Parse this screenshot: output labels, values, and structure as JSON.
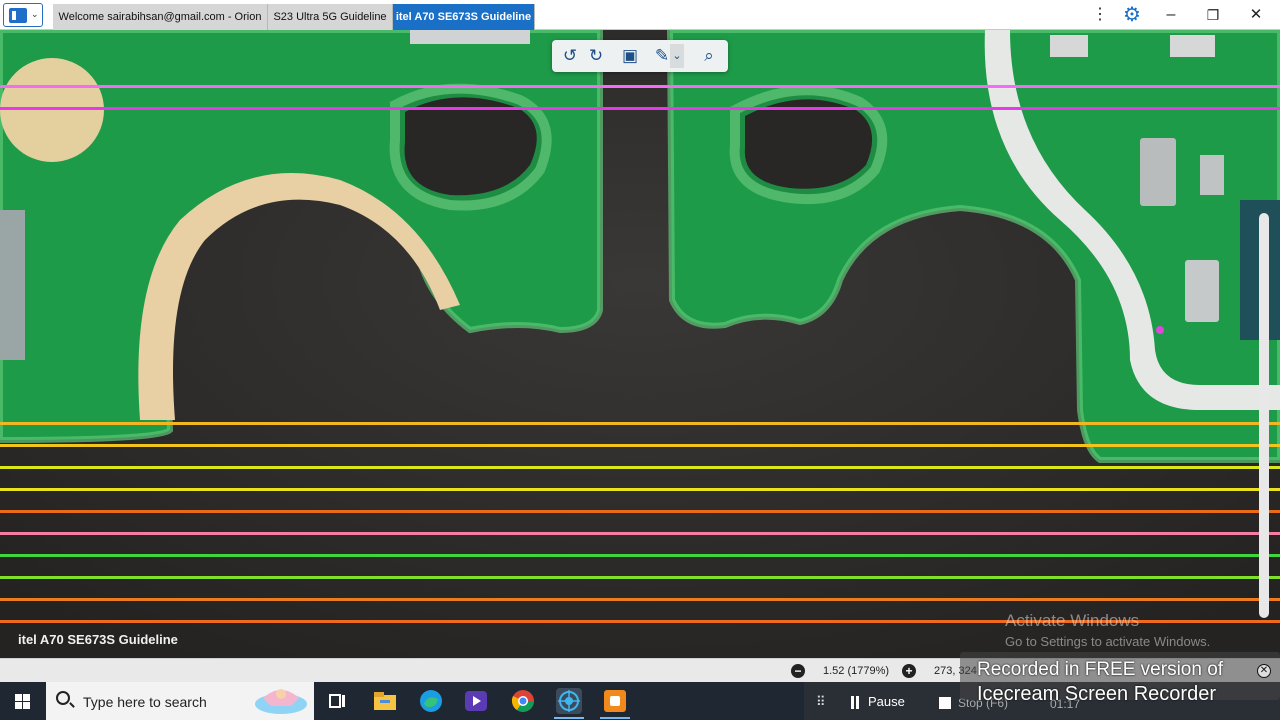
{
  "window": {
    "tabs": [
      {
        "label": "Welcome sairabihsan@gmail.com - Orion",
        "active": false
      },
      {
        "label": "S23 Ultra 5G Guideline",
        "active": false
      },
      {
        "label": "itel A70 SE673S Guideline",
        "active": true
      }
    ],
    "controls": {
      "kebab": "⋮",
      "settings": "⚙",
      "minimize": "–",
      "restore": "❐",
      "close": "✕"
    }
  },
  "viewer": {
    "caption": "itel A70 SE673S Guideline",
    "trace_colors": [
      "#f36cf3",
      "#e53ae6",
      "#f2b622",
      "#f3c41c",
      "#d8e81d",
      "#e9e21f",
      "#ea6a19",
      "#f47ea3",
      "#3ed63b",
      "#7fe02a",
      "#ef7b1f",
      "#ef6a1f"
    ],
    "toolbar_icons": [
      "rotate-left-icon",
      "rotate-right-icon",
      "fit-screen-icon",
      "pen-icon",
      "chevron-down-icon",
      "search-icon"
    ]
  },
  "status": {
    "zoom": "1.52 (1779%)",
    "coords": "273, 324"
  },
  "watermark": {
    "line1": "Activate Windows",
    "line2": "Go to Settings to activate Windows."
  },
  "recorder": {
    "line1": "Recorded in FREE version of",
    "line2": "Icecream  Screen  Recorder",
    "pause": "Pause",
    "stop": "Stop (F6)",
    "time": "01:17"
  },
  "taskbar": {
    "search_placeholder": "Type here to search"
  }
}
